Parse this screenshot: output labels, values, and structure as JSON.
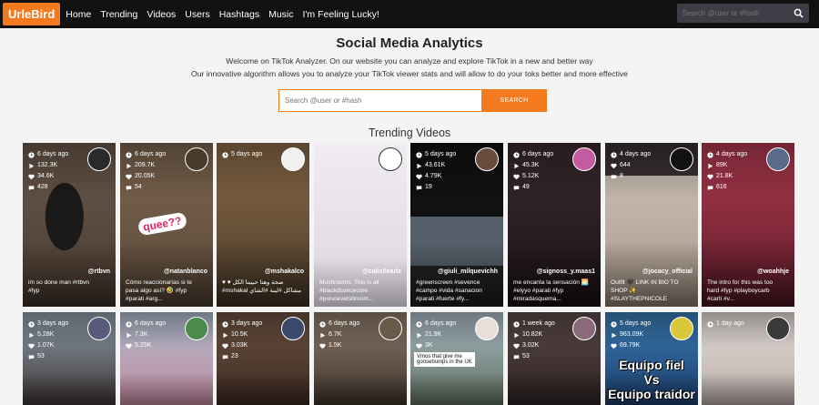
{
  "nav": {
    "logo": "UrleBird",
    "links": [
      "Home",
      "Trending",
      "Videos",
      "Users",
      "Hashtags",
      "Music",
      "I'm Feeling Lucky!"
    ],
    "search_placeholder": "Search @user or #hash"
  },
  "hero": {
    "title": "Social Media Analytics",
    "welcome_1": "Welcome on TikTok Analyzer. On our website you can analyze and explore TikTok in a new and better way",
    "welcome_2": "Our innovative algorithm allows you to analyze your TikTok viewer stats and will allow to do your toks better and more effective",
    "search_placeholder": "Search @user or #hash",
    "search_button": "SEARCH"
  },
  "trending": {
    "title": "Trending Videos",
    "row1": [
      {
        "time": "6 days ago",
        "plays": "132.3K",
        "likes": "34.6K",
        "comments": "428",
        "handle": "@rtbvn",
        "desc": "im so done man #rtbvn\n#fyp",
        "bg": "#5a4a3c"
      },
      {
        "time": "6 days ago",
        "plays": "209.7K",
        "likes": "20.05K",
        "comments": "54",
        "handle": "@natanblanco",
        "desc": "Cómo reaccionarías si te\npasa algo así? 🤣 #fyp\n#parati #arg...",
        "bg": "#6f5a48",
        "overlay": "quee??"
      },
      {
        "time": "5 days ago",
        "plays": "",
        "likes": "",
        "comments": "",
        "handle": "@mshakalco",
        "desc": "♥ ♥ صحة وهنا حبيبنا الكل\n#mshakal مشاكل #لبنة #الشاي",
        "bg": "#7a5f42"
      },
      {
        "time": "",
        "plays": "",
        "likes": "",
        "comments": "",
        "handle": "@calistleartz",
        "desc": "Mushrooms. This is all\n#blackdconcecore\n#poisoevetsbroom...",
        "bg": "#eae6ee"
      },
      {
        "time": "5 days ago",
        "plays": "43.61K",
        "likes": "4.79K",
        "comments": "19",
        "handle": "@giuli_milquevichh",
        "desc": "#greenscreen #sevence\n#campo #vida #sanacion\n#parati #fuerte #fy...",
        "bg": "#2c2c2c"
      },
      {
        "time": "6 days ago",
        "plays": "45.3K",
        "likes": "5.12K",
        "comments": "49",
        "handle": "@signoss_y.maas1",
        "desc": "me encanta la sensación 🌅\n#elyyo #parati #fyp\n#miradasquema...",
        "bg": "#2a1e24"
      },
      {
        "time": "4 days ago",
        "plays": "",
        "likes": "644",
        "comments": "8",
        "handle": "@jocacy_official",
        "desc": "Outfit 🖤 LINK IN BIO TO\nSHOP ✨ #SLAYTHEPNICOLE\nTOP #top #kha...",
        "bg": "#d8d0c8"
      },
      {
        "time": "4 days ago",
        "plays": "89K",
        "likes": "21.8K",
        "comments": "616",
        "handle": "@woahhje",
        "desc": "The intro for this was too\nhard #fyp #playboycarb\n#carti #v...",
        "bg": "#8a2a3c"
      }
    ],
    "row2": [
      {
        "time": "3 days ago",
        "plays": "5.28K",
        "likes": "1.07K",
        "comments": "53",
        "bg": "#6a7a86"
      },
      {
        "time": "6 days ago",
        "plays": "7.3K",
        "likes": "5.25K",
        "comments": "",
        "bg": "#8fa0b0"
      },
      {
        "time": "3 days ago",
        "plays": "10.5K",
        "likes": "3.03K",
        "comments": "23",
        "bg": "#5a4030"
      },
      {
        "time": "6 days ago",
        "plays": "6.7K",
        "likes": "1.5K",
        "comments": "",
        "bg": "#6a5a50"
      },
      {
        "time": "6 days ago",
        "plays": "21.9K",
        "likes": "3K",
        "comments": "",
        "bg": "#7a8894",
        "overlay": "Vmos that give me\ngoosebumps in the UK"
      },
      {
        "time": "1 week ago",
        "plays": "10.82K",
        "likes": "3.02K",
        "comments": "53",
        "bg": "#4a3a3a"
      },
      {
        "time": "5 days ago",
        "plays": "963.09K",
        "likes": "69.79K",
        "comments": "",
        "bg": "#2a6a9a",
        "overlay": "Equipo fiel\nVs\nEquipo traidor"
      },
      {
        "time": "1 day ago",
        "plays": "",
        "likes": "",
        "comments": "",
        "bg": "#d4ccc8"
      }
    ]
  },
  "colors": {
    "accent": "#f47a20",
    "navbar": "#111111"
  }
}
